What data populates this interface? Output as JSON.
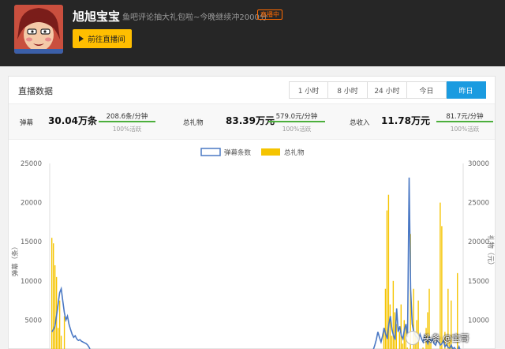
{
  "header": {
    "streamer_name": "旭旭宝宝",
    "room_description": "鱼吧评论抽大礼包啦~今晚继续冲2000分",
    "live_badge": "直播中",
    "go_to_room_label": "前往直播间"
  },
  "panel": {
    "title": "直播数据",
    "tabs": [
      {
        "label": "1 小时",
        "active": false
      },
      {
        "label": "8 小时",
        "active": false
      },
      {
        "label": "24 小时",
        "active": false
      },
      {
        "label": "今日",
        "active": false
      },
      {
        "label": "昨日",
        "active": true
      }
    ]
  },
  "stats": {
    "danmu": {
      "label": "弹幕",
      "value": "30.04万条",
      "rate": "208.6条/分钟",
      "active": "100%活跃"
    },
    "gift": {
      "label": "总礼物",
      "value": "83.39万元",
      "rate": "579.0元/分钟",
      "active": "100%活跃"
    },
    "income": {
      "label": "总收入",
      "value": "11.78万元",
      "rate": "81.7元/分钟",
      "active": "100%活跃"
    }
  },
  "watermark": {
    "text": "头条 @宝哥"
  },
  "colors": {
    "accent": "#1a9be0",
    "button": "#ffbe00",
    "danmu_series": "#4a78c4",
    "gift_series": "#f5c400",
    "rate_bar": "#4caf3c"
  },
  "chart_data": {
    "type": "bar",
    "legend": [
      "弹幕条数",
      "总礼物"
    ],
    "left_axis": {
      "label": "弹幕（条）",
      "ticks": [
        "25000",
        "20000",
        "15000",
        "10000",
        "5000"
      ],
      "ylim": [
        0,
        25000
      ]
    },
    "right_axis": {
      "label": "礼物（元）",
      "ticks": [
        "30000",
        "25000",
        "20000",
        "15000",
        "10000",
        "5000"
      ],
      "ylim": [
        0,
        30000
      ]
    },
    "series": [
      {
        "name": "总礼物",
        "axis": "right",
        "values": [
          20500,
          19800,
          17000,
          15500,
          9000,
          12500,
          8000,
          5000,
          10500,
          6000,
          4500,
          3500,
          5500,
          4200,
          3000,
          2500,
          3200,
          2000,
          2800,
          1500,
          2200,
          1800,
          1200,
          1000,
          500,
          300,
          200,
          100,
          0,
          0,
          0,
          0,
          0,
          0,
          0,
          0,
          0,
          0,
          0,
          0,
          0,
          0,
          0,
          0,
          0,
          0,
          0,
          0,
          0,
          0,
          0,
          0,
          0,
          0,
          0,
          0,
          0,
          0,
          0,
          0,
          0,
          0,
          0,
          0,
          0,
          0,
          0,
          0,
          0,
          0,
          0,
          0,
          0,
          0,
          0,
          0,
          0,
          0,
          0,
          0,
          0,
          0,
          0,
          0,
          0,
          0,
          0,
          0,
          0,
          0,
          0,
          0,
          0,
          0,
          0,
          0,
          0,
          0,
          0,
          0,
          0,
          0,
          0,
          0,
          0,
          0,
          0,
          0,
          0,
          0,
          0,
          0,
          0,
          0,
          0,
          0,
          0,
          0,
          300,
          0,
          0,
          0,
          0,
          0,
          0,
          0,
          0,
          0,
          0,
          0,
          0,
          0,
          0,
          0,
          0,
          0,
          0,
          0,
          0,
          0,
          0,
          0,
          0,
          0,
          0,
          0,
          0,
          0,
          0,
          0,
          0,
          0,
          0,
          0,
          0,
          0,
          0,
          0,
          0,
          0,
          0,
          0,
          0,
          0,
          0,
          0,
          0,
          0,
          0,
          0,
          0,
          0,
          0,
          0,
          0,
          0,
          0,
          0,
          0,
          0,
          0,
          0,
          0,
          0,
          0,
          0,
          0,
          0,
          0,
          0,
          0,
          0,
          0,
          0,
          0,
          0,
          0,
          0,
          0,
          0,
          0,
          0,
          0,
          0,
          0,
          300,
          500,
          900,
          1500,
          2500,
          3500,
          6000,
          9000,
          14000,
          24000,
          26000,
          12000,
          8000,
          15000,
          11000,
          9500,
          6000,
          8500,
          12000,
          7000,
          10000,
          9000,
          6500,
          4500,
          21000,
          5500,
          14000,
          8500,
          10000,
          12500,
          4000,
          4500,
          6500,
          3000,
          9000,
          11000,
          14000,
          7500,
          5500,
          2500,
          1500,
          6000,
          3500,
          25000,
          22000,
          3000,
          8500,
          4000,
          14000,
          7500,
          12500,
          5500,
          4000,
          6000,
          16000,
          4500,
          2000
        ],
        "start_index": 0
      },
      {
        "name": "弹幕条数",
        "axis": "left",
        "values": [
          3500,
          3800,
          4200,
          5500,
          7000,
          8500,
          9000,
          7500,
          6000,
          5000,
          5500,
          4500,
          3800,
          3200,
          2800,
          3000,
          2600,
          2400,
          2500,
          2300,
          2200,
          2100,
          2000,
          1800,
          1500,
          1000,
          600,
          300,
          100,
          0,
          0,
          0,
          0,
          0,
          0,
          0,
          0,
          0,
          0,
          0,
          0,
          0,
          0,
          0,
          0,
          0,
          0,
          0,
          0,
          0,
          0,
          0,
          0,
          0,
          0,
          0,
          0,
          0,
          0,
          0,
          0,
          0,
          0,
          0,
          0,
          0,
          0,
          0,
          0,
          0,
          0,
          0,
          0,
          0,
          0,
          0,
          0,
          0,
          0,
          0,
          0,
          0,
          0,
          0,
          0,
          0,
          0,
          0,
          0,
          0,
          0,
          0,
          0,
          0,
          0,
          0,
          0,
          0,
          0,
          0,
          0,
          0,
          0,
          0,
          0,
          0,
          0,
          0,
          0,
          0,
          0,
          0,
          0,
          0,
          0,
          0,
          0,
          0,
          0,
          0,
          0,
          0,
          0,
          0,
          0,
          0,
          0,
          0,
          0,
          0,
          0,
          0,
          0,
          0,
          0,
          0,
          0,
          0,
          0,
          0,
          0,
          0,
          0,
          0,
          0,
          0,
          0,
          0,
          0,
          0,
          0,
          0,
          0,
          0,
          0,
          0,
          0,
          0,
          0,
          0,
          0,
          0,
          0,
          0,
          0,
          0,
          0,
          0,
          0,
          0,
          0,
          0,
          0,
          0,
          0,
          0,
          0,
          0,
          0,
          0,
          0,
          0,
          0,
          0,
          0,
          0,
          0,
          0,
          0,
          0,
          0,
          0,
          0,
          0,
          0,
          0,
          0,
          0,
          0,
          0,
          0,
          0,
          0,
          100,
          300,
          800,
          1200,
          1800,
          2500,
          3500,
          2800,
          2200,
          3000,
          4000,
          3200,
          2600,
          4500,
          5500,
          3800,
          3000,
          2500,
          6500,
          3500,
          4200,
          3000,
          2600,
          3800,
          4500,
          2800,
          23200,
          9000,
          4500,
          3500,
          3000,
          2800,
          2500,
          3200,
          2600,
          2200,
          3000,
          2500,
          2000,
          2800,
          2200,
          2600,
          2000,
          1800,
          2500,
          2200,
          1800,
          2000,
          2400,
          1600,
          1900,
          1500,
          1400,
          1800,
          1300,
          1500,
          1200,
          1100,
          1600,
          1000
        ],
        "start_index": 0
      }
    ]
  }
}
